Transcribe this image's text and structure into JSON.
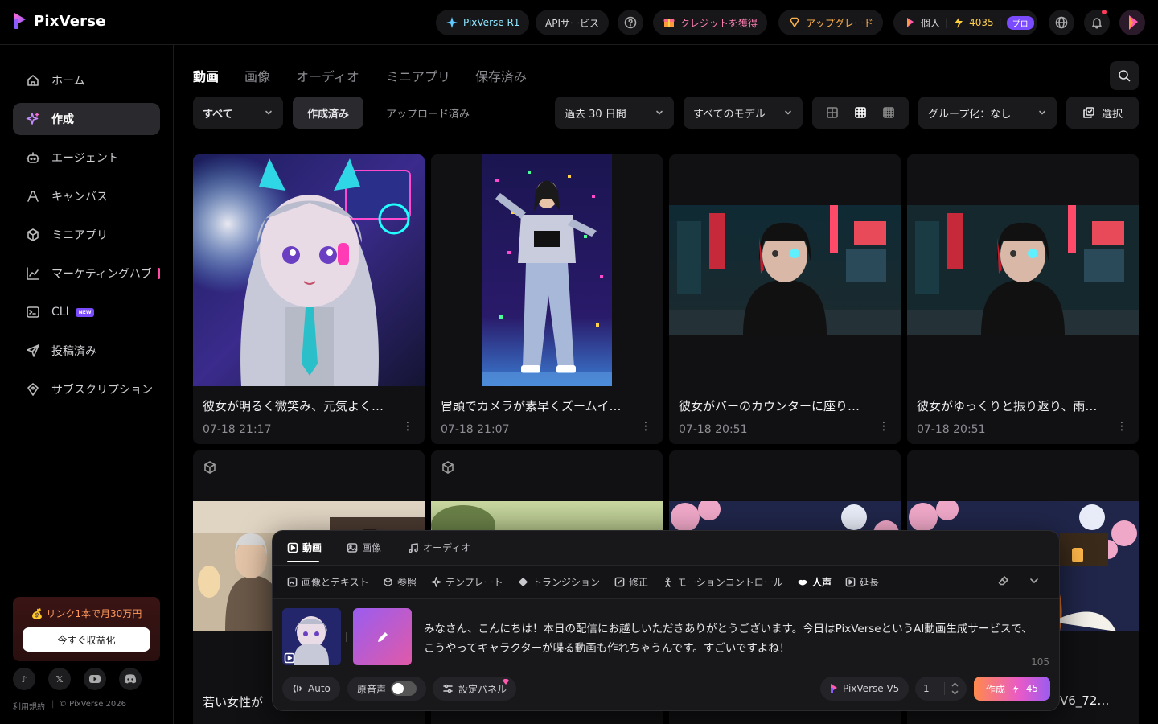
{
  "brand": {
    "name": "PixVerse",
    "accent": "#c48cff"
  },
  "topbar": {
    "r1_label": "PixVerse R1",
    "api_label": "APIサービス",
    "credits_label": "クレジットを獲得",
    "upgrade_label": "アップグレード",
    "account_label": "個人",
    "credit_count": "4035",
    "plan_badge": "プロ"
  },
  "sidebar": {
    "items": [
      {
        "label": "ホーム",
        "icon": "home-icon"
      },
      {
        "label": "作成",
        "icon": "sparkle-icon"
      },
      {
        "label": "エージェント",
        "icon": "robot-icon"
      },
      {
        "label": "キャンバス",
        "icon": "canvas-icon"
      },
      {
        "label": "ミニアプリ",
        "icon": "cube-icon"
      },
      {
        "label": "マーケティングハブ",
        "icon": "chart-icon"
      },
      {
        "label": "CLI",
        "icon": "terminal-icon",
        "badge": "NEW"
      },
      {
        "label": "投稿済み",
        "icon": "send-icon"
      },
      {
        "label": "サブスクリプション",
        "icon": "diamond-icon"
      }
    ],
    "promo_title": "💰 リンク1本で月30万円",
    "promo_button": "今すぐ収益化",
    "footer_terms": "利用規約",
    "footer_copyright": "© PixVerse 2026"
  },
  "main": {
    "tabs": [
      "動画",
      "画像",
      "オーディオ",
      "ミニアプリ",
      "保存済み"
    ],
    "filters": {
      "all": "すべて",
      "created": "作成済み",
      "uploaded": "アップロード済み",
      "period": "過去 30 日間",
      "models": "すべてのモデル",
      "group": "グループ化：なし",
      "select": "選択"
    },
    "cards": [
      {
        "title": "彼女が明るく微笑み、元気よく…",
        "date": "07-18  21:17"
      },
      {
        "title": "冒頭でカメラが素早くズームイ…",
        "date": "07-18  21:07"
      },
      {
        "title": "彼女がバーのカウンターに座り…",
        "date": "07-18  20:51"
      },
      {
        "title": "彼女がゆっくりと振り返り、雨…",
        "date": "07-18  20:51"
      },
      {
        "title": "若い女性が",
        "date": ""
      },
      {
        "title": "",
        "date": ""
      },
      {
        "title": "",
        "date": ""
      },
      {
        "title": "V6_72…",
        "date": ""
      }
    ]
  },
  "composer": {
    "tabs": [
      "動画",
      "画像",
      "オーディオ"
    ],
    "tools": [
      "画像とテキスト",
      "参照",
      "テンプレート",
      "トランジション",
      "修正",
      "モーションコントロール",
      "人声",
      "延長"
    ],
    "prompt": "みなさん、こんにちは！本日の配信にお越しいただきありがとうございます。今日はPixVerseというAI動画生成サービスで、こうやってキャラクターが喋る動画も作れちゃうんです。すごいですよね！",
    "char_count": "105",
    "auto_label": "Auto",
    "original_audio_label": "原音声",
    "settings_label": "設定パネル",
    "model_label": "PixVerse V5",
    "quantity": "1",
    "create_label": "作成",
    "create_cost": "45"
  }
}
